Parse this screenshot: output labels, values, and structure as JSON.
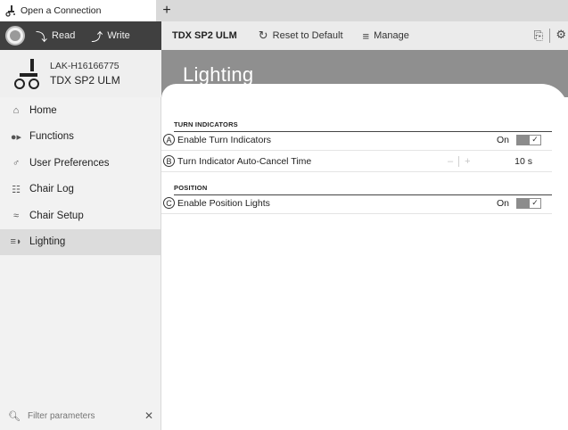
{
  "tab": {
    "label": "Open a Connection",
    "add_label": "+"
  },
  "toolbar_left": {
    "read_label": "Read",
    "write_label": "Write"
  },
  "toolbar_right": {
    "title": "TDX SP2 ULM",
    "reset_label": "Reset to Default",
    "manage_label": "Manage"
  },
  "device": {
    "serial": "LAK-H16166775",
    "model": "TDX SP2 ULM"
  },
  "page": {
    "title": "Lighting"
  },
  "sidebar": {
    "items": [
      {
        "label": "Home",
        "icon": "home-icon"
      },
      {
        "label": "Functions",
        "icon": "functions-icon"
      },
      {
        "label": "User Preferences",
        "icon": "user-icon"
      },
      {
        "label": "Chair Log",
        "icon": "clipboard-icon"
      },
      {
        "label": "Chair Setup",
        "icon": "chair-setup-icon"
      },
      {
        "label": "Lighting",
        "icon": "lighting-icon",
        "active": true
      }
    ],
    "filter_placeholder": "Filter parameters"
  },
  "sections": [
    {
      "header": "TURN INDICATORS",
      "rows": [
        {
          "letter": "A",
          "label": "Enable Turn Indicators",
          "type": "toggle",
          "state": "On",
          "checked": true
        },
        {
          "letter": "B",
          "label": "Turn Indicator Auto-Cancel Time",
          "type": "stepper",
          "minus": "–",
          "plus": "+",
          "value": "10 s"
        }
      ]
    },
    {
      "header": "POSITION",
      "rows": [
        {
          "letter": "C",
          "label": "Enable Position Lights",
          "type": "toggle",
          "state": "On",
          "checked": true
        }
      ]
    }
  ],
  "colors": {
    "toolbar_dark": "#404040",
    "banner": "#8f8f8f",
    "toggle_on": "#8c8c8c",
    "sidebar_active": "#dcdcdc"
  }
}
